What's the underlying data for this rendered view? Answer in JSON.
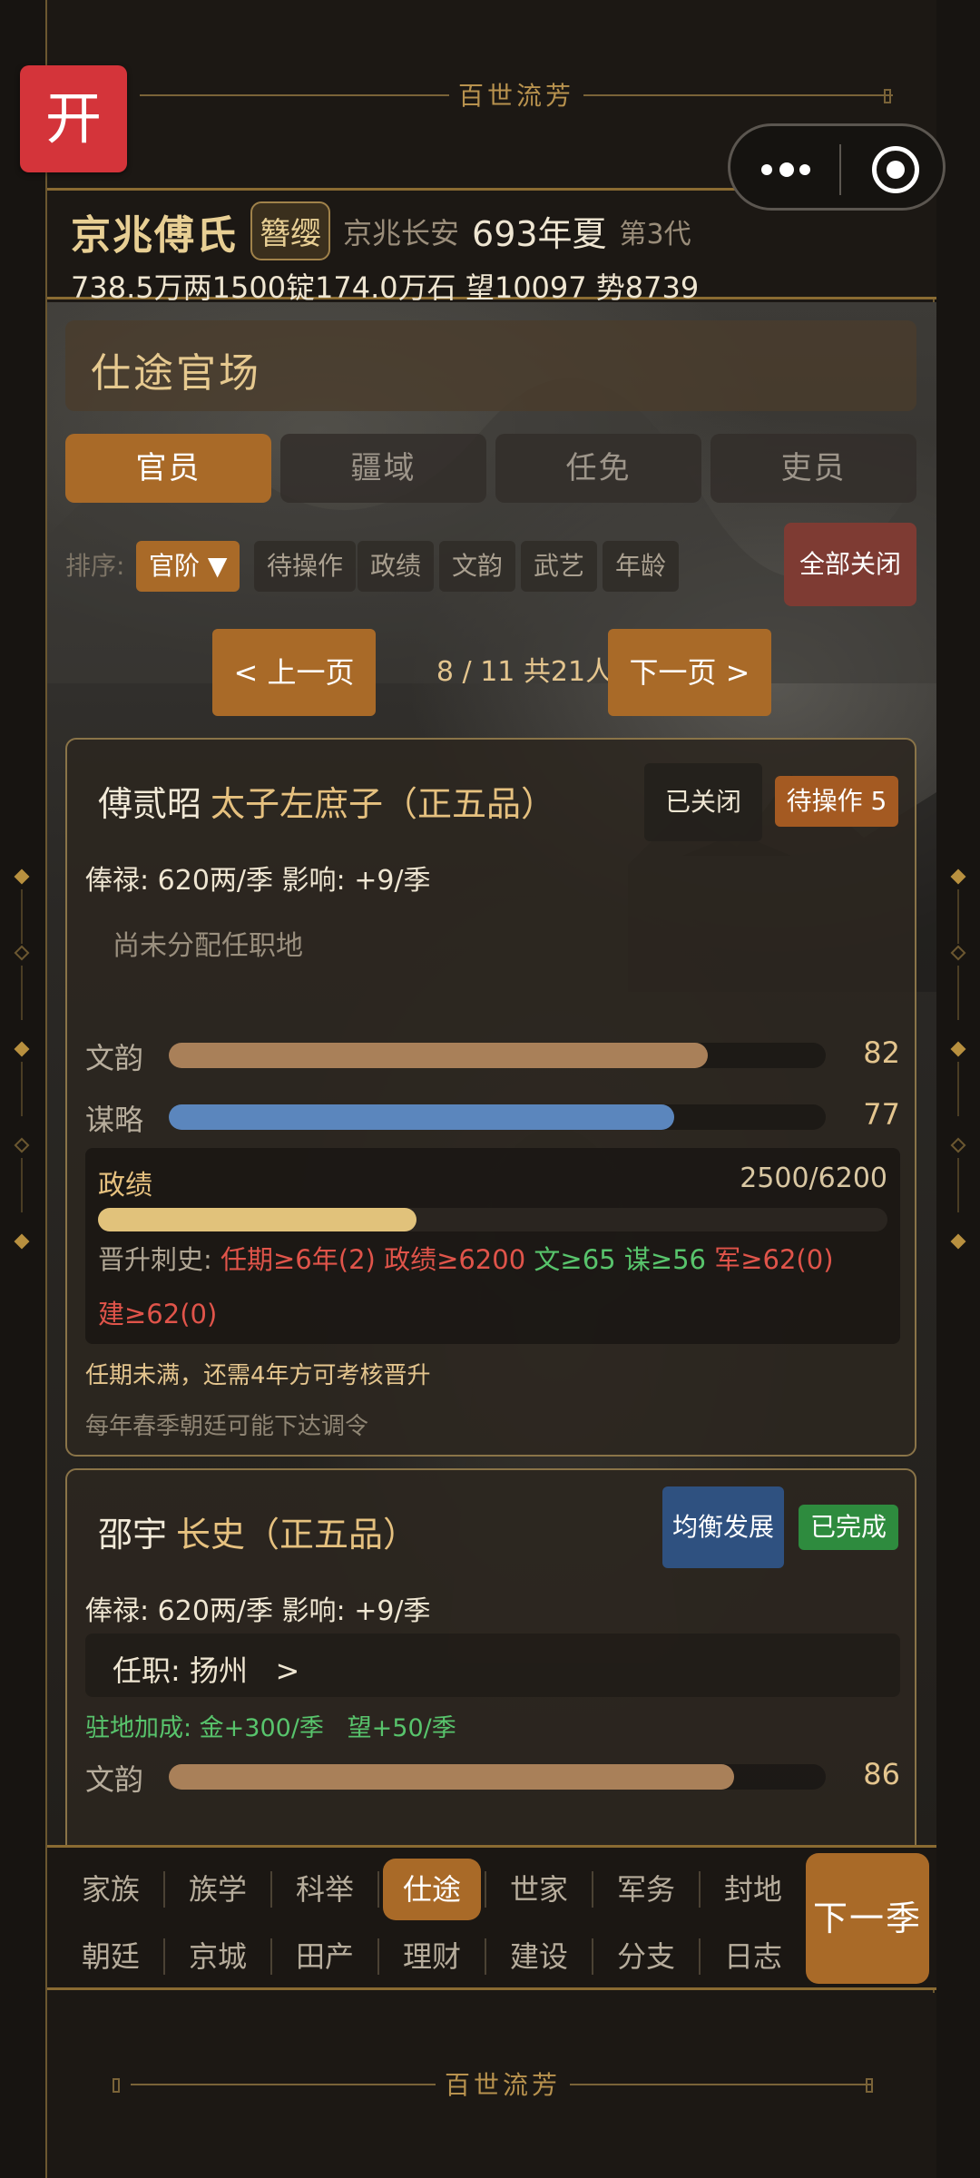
{
  "banner": {
    "title": "百世流芳"
  },
  "kai_button": "开",
  "family": {
    "name": "京兆傅氏",
    "badge": "簪缨",
    "location": "京兆长安",
    "year": "693年夏",
    "generation": "第3代",
    "resources": "738.5万两1500锭174.0万石  望10097 势8739"
  },
  "section": {
    "title": "仕途官场"
  },
  "tabs": [
    {
      "label": "官员",
      "active": true
    },
    {
      "label": "疆域",
      "active": false
    },
    {
      "label": "任免",
      "active": false
    },
    {
      "label": "吏员",
      "active": false
    }
  ],
  "sort": {
    "label": "排序:",
    "options": [
      "官阶 ▼",
      "待操作",
      "政绩",
      "文韵",
      "武艺",
      "年龄"
    ],
    "close_all": "全部关闭"
  },
  "pager": {
    "prev": "< 上一页",
    "info": "8 / 11  共21人",
    "next": "下一页 >"
  },
  "cards": [
    {
      "name": "傅贰昭",
      "position": "太子左庶子（正五品）",
      "tag_closed": "已关闭",
      "tag_pending": "待操作 5",
      "salary": "俸禄: 620两/季   影响: +9/季",
      "assignment": "尚未分配任职地",
      "stats": [
        {
          "label": "文韵",
          "value": 82,
          "max": 100,
          "color": "#a98059"
        },
        {
          "label": "谋略",
          "value": 77,
          "max": 100,
          "color": "#5b86bd"
        }
      ],
      "merit": {
        "label": "政绩",
        "text": "2500/6200",
        "value": 2500,
        "max": 6200
      },
      "promotion": {
        "label": "晋升刺史:",
        "reqs": [
          {
            "text": "任期≥6年(2)",
            "met": false
          },
          {
            "text": "政绩≥6200",
            "met": false
          },
          {
            "text": "文≥65",
            "met": true
          },
          {
            "text": "谋≥56",
            "met": true
          },
          {
            "text": "军≥62(0)",
            "met": false
          }
        ],
        "reqs_line2": [
          {
            "text": "建≥62(0)",
            "met": false
          }
        ]
      },
      "note1": "任期未满，还需4年方可考核晋升",
      "note2": "每年春季朝廷可能下达调令"
    },
    {
      "name": "邵宇",
      "position": "长史（正五品）",
      "tag_strategy": "均衡发展",
      "tag_done": "已完成",
      "salary": "俸禄: 620两/季   影响: +9/季",
      "assignment": "任职: 扬州   >",
      "bonus": "驻地加成: 金+300/季   望+50/季",
      "stats": [
        {
          "label": "文韵",
          "value": 86,
          "max": 100,
          "color": "#a98059"
        }
      ]
    }
  ],
  "nav": {
    "row1": [
      "家族",
      "族学",
      "科举",
      "仕途",
      "世家",
      "军务",
      "封地"
    ],
    "row2": [
      "朝廷",
      "京城",
      "田产",
      "理财",
      "建设",
      "分支",
      "日志"
    ],
    "active": "仕途",
    "next_season": "下一季"
  },
  "colors": {
    "accent": "#a96a28",
    "gold_text": "#e6c17f",
    "red_btn": "#d4343a",
    "ok_green": "#2e8b3e",
    "strategy_blue": "#2f5180"
  }
}
